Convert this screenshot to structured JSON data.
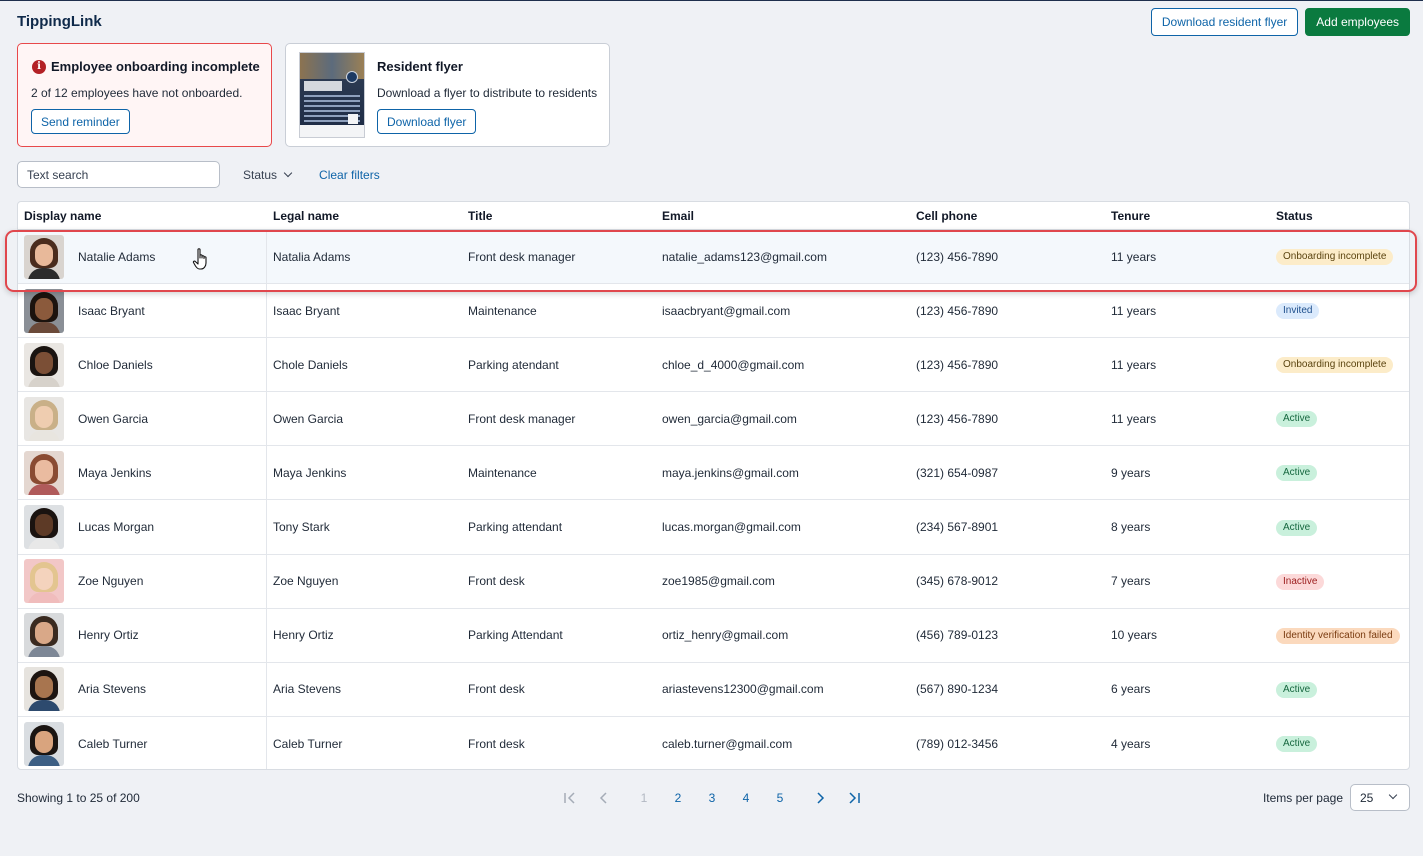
{
  "app": {
    "title": "TippingLink"
  },
  "header": {
    "download_flyer_label": "Download resident flyer",
    "add_employees_label": "Add employees"
  },
  "alert_card": {
    "title": "Employee onboarding incomplete",
    "message": "2 of 12 employees have not onboarded.",
    "button_label": "Send reminder",
    "icon": "info-icon"
  },
  "flyer_card": {
    "title": "Resident flyer",
    "message": "Download a flyer to distribute to residents",
    "button_label": "Download flyer"
  },
  "filters": {
    "search_placeholder": "Text search",
    "status_label": "Status",
    "clear_label": "Clear filters"
  },
  "table": {
    "columns": [
      "Display name",
      "Legal name",
      "Title",
      "Email",
      "Cell phone",
      "Tenure",
      "Status"
    ],
    "rows": [
      {
        "display": "Natalie Adams",
        "legal": "Natalia Adams",
        "title": "Front desk manager",
        "email": "natalie_adams123@gmail.com",
        "phone": "(123) 456-7890",
        "tenure": "11 years",
        "status": "Onboarding incomplete",
        "status_kind": "onboard",
        "avatar": {
          "bg": "#d9d4cf",
          "hair": "#4a2c1d",
          "skin": "#e8b99a",
          "shirt": "#2c2c2c"
        }
      },
      {
        "display": "Isaac Bryant",
        "legal": "Isaac Bryant",
        "title": "Maintenance",
        "email": "isaacbryant@gmail.com",
        "phone": "(123) 456-7890",
        "tenure": "11 years",
        "status": "Invited",
        "status_kind": "invited",
        "avatar": {
          "bg": "#8a8f96",
          "hair": "#1c130e",
          "skin": "#8b5a3c",
          "shirt": "#6b4a3a"
        }
      },
      {
        "display": "Chloe Daniels",
        "legal": "Chole Daniels",
        "title": "Parking atendant",
        "email": "chloe_d_4000@gmail.com",
        "phone": "(123) 456-7890",
        "tenure": "11 years",
        "status": "Onboarding incomplete",
        "status_kind": "onboard",
        "avatar": {
          "bg": "#e9e6e2",
          "hair": "#1a1411",
          "skin": "#7b4f36",
          "shirt": "#d7d2cb"
        }
      },
      {
        "display": "Owen Garcia",
        "legal": "Owen Garcia",
        "title": "Front desk manager",
        "email": "owen_garcia@gmail.com",
        "phone": "(123) 456-7890",
        "tenure": "11 years",
        "status": "Active",
        "status_kind": "active",
        "avatar": {
          "bg": "#e8e6e3",
          "hair": "#c9b088",
          "skin": "#efcdb0",
          "shirt": "#e8e5df"
        }
      },
      {
        "display": "Maya Jenkins",
        "legal": "Maya Jenkins",
        "title": "Maintenance",
        "email": "maya.jenkins@gmail.com",
        "phone": "(321) 654-0987",
        "tenure": "9 years",
        "status": "Active",
        "status_kind": "active",
        "avatar": {
          "bg": "#e4d7d0",
          "hair": "#8a4b32",
          "skin": "#eabba0",
          "shirt": "#b05a5a"
        }
      },
      {
        "display": "Lucas Morgan",
        "legal": "Tony Stark",
        "title": "Parking attendant",
        "email": "lucas.morgan@gmail.com",
        "phone": "(234) 567-8901",
        "tenure": "8 years",
        "status": "Active",
        "status_kind": "active",
        "avatar": {
          "bg": "#dde0e3",
          "hair": "#1a1310",
          "skin": "#5d3a26",
          "shirt": "#e8e8e8"
        }
      },
      {
        "display": "Zoe Nguyen",
        "legal": "Zoe Nguyen",
        "title": "Front desk",
        "email": "zoe1985@gmail.com",
        "phone": "(345) 678-9012",
        "tenure": "7 years",
        "status": "Inactive",
        "status_kind": "inactive",
        "avatar": {
          "bg": "#f2c7c7",
          "hair": "#e3c590",
          "skin": "#f4d3bd",
          "shirt": "#f0bcbc"
        }
      },
      {
        "display": "Henry Ortiz",
        "legal": "Henry Ortiz",
        "title": "Parking Attendant",
        "email": "ortiz_henry@gmail.com",
        "phone": "(456) 789-0123",
        "tenure": "10 years",
        "status": "Identity verification failed",
        "status_kind": "failed",
        "avatar": {
          "bg": "#d8dadc",
          "hair": "#3a2a20",
          "skin": "#d9a888",
          "shirt": "#7d8796"
        }
      },
      {
        "display": "Aria Stevens",
        "legal": "Aria Stevens",
        "title": "Front desk",
        "email": "ariastevens12300@gmail.com",
        "phone": "(567) 890-1234",
        "tenure": "6 years",
        "status": "Active",
        "status_kind": "active",
        "avatar": {
          "bg": "#e6e3de",
          "hair": "#1d1410",
          "skin": "#a8754f",
          "shirt": "#2d4a6e"
        }
      },
      {
        "display": "Caleb Turner",
        "legal": "Caleb Turner",
        "title": "Front desk",
        "email": "caleb.turner@gmail.com",
        "phone": "(789) 012-3456",
        "tenure": "4 years",
        "status": "Active",
        "status_kind": "active",
        "avatar": {
          "bg": "#d9dde1",
          "hair": "#1b1512",
          "skin": "#d9a47e",
          "shirt": "#3d5f84"
        }
      }
    ]
  },
  "pagination": {
    "showing": "Showing 1 to 25  of 200",
    "pages": [
      "1",
      "2",
      "3",
      "4",
      "5"
    ],
    "current_page": "1",
    "items_per_page_label": "Items per page",
    "items_per_page": "25"
  },
  "colors": {
    "primary": "#0e64a8",
    "success": "#0a7a3f",
    "alert": "#e8484a",
    "highlight": "#e0474d"
  }
}
